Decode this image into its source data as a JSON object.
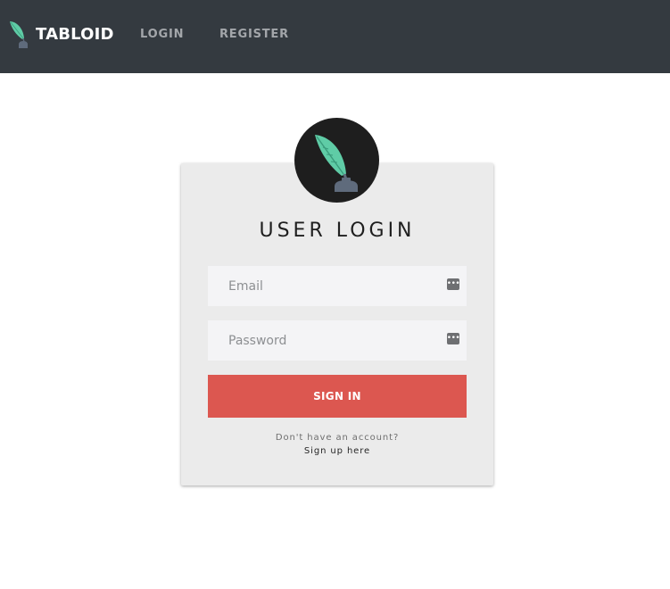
{
  "navbar": {
    "brand": "TABLOID",
    "links": [
      {
        "label": "LOGIN"
      },
      {
        "label": "REGISTER"
      }
    ]
  },
  "login_card": {
    "title": "USER LOGIN",
    "email": {
      "placeholder": "Email",
      "value": ""
    },
    "password": {
      "placeholder": "Password",
      "value": ""
    },
    "key_icon": "password-manager-key-icon",
    "submit_label": "SIGN IN",
    "account_prompt": "Don't have an account?",
    "signup_label": "Sign up here"
  },
  "icons": {
    "brand": "quill-inkwell-icon",
    "avatar": "quill-inkwell-icon"
  },
  "colors": {
    "navbar_bg": "#343a40",
    "card_bg": "#ebebeb",
    "button_bg": "#dc5750",
    "quill": "#5fcca6",
    "inkwell": "#5f6b7c"
  }
}
